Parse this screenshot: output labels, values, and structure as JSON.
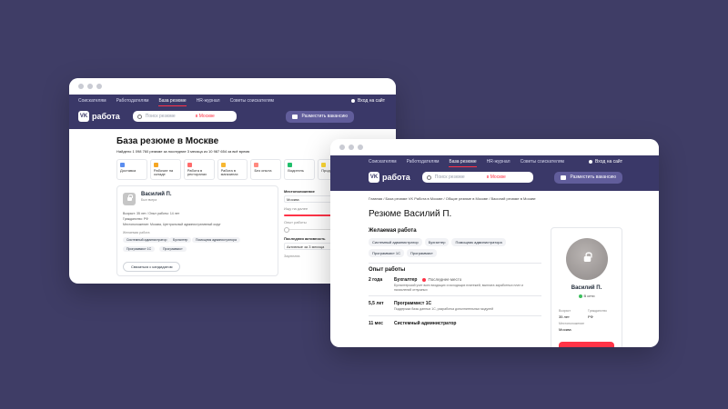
{
  "brand": {
    "logo_mark": "VK",
    "logo_text": "работа"
  },
  "nav": {
    "items": [
      "Соискателям",
      "Работодателям",
      "База резюме",
      "HR-журнал",
      "Советы соискателям"
    ],
    "active_index": 2,
    "login": "Вход на сайт"
  },
  "search": {
    "placeholder": "Поиск резюме",
    "city": "в Москве"
  },
  "post_vacancy": "Разместить вакансию",
  "base_page": {
    "title": "База резюме в Москве",
    "subtitle": "Найдено 1 098 760 резюме за последние 3 месяца из 10 987 654 за всё время",
    "categories": [
      {
        "label": "Доставка",
        "color": "#5b8def",
        "icon": "delivery-icon"
      },
      {
        "label": "Рабочие на складе",
        "color": "#f5a623",
        "icon": "warehouse-icon"
      },
      {
        "label": "Работа в ресторанах",
        "color": "#ff6b6b",
        "icon": "restaurant-icon"
      },
      {
        "label": "Работа в магазинах",
        "color": "#f7b731",
        "icon": "store-icon"
      },
      {
        "label": "Без опыта",
        "color": "#ff8a80",
        "icon": "no-experience-icon"
      },
      {
        "label": "Водитель",
        "color": "#20bf6b",
        "icon": "driver-icon"
      },
      {
        "label": "Прод",
        "color": "#fdd835",
        "icon": "sales-icon"
      }
    ],
    "card": {
      "name": "Василий П.",
      "online": "Был вчера",
      "age_exp": "Возраст: 35 лет / Опыт работы: 14 лет",
      "citizenship": "Гражданство: РФ",
      "location": "Местоположение: Москва, Центральный административный округ",
      "desired_label": "Желаемая работа",
      "chips": [
        "Системный администратор",
        "Бухгалтер",
        "Помощник администратора",
        "Программист 1С",
        "Программист"
      ],
      "contact": "Связаться с кандидатом"
    },
    "filters": {
      "location_label": "Местоположение",
      "location_value": "Москва",
      "age_label": "Ищу на далее",
      "experience_label": "Опыт работы",
      "activity_label": "Последняя активность",
      "activity_value": "Активные за 3 месяца",
      "salary_label": "Зарплата"
    }
  },
  "resume_page": {
    "breadcrumb": "Главная / База резюме VK Работа в Москве / Общие резюме в Москве / Василий резюме в Москве",
    "title": "Резюме Василий П.",
    "desired_title": "Желаемая работа",
    "chips": [
      "Системный администратор",
      "Бухгалтер",
      "Помощник администратора",
      "Программист 1С",
      "Программист"
    ],
    "experience_title": "Опыт работы",
    "experience": [
      {
        "duration": "2 года",
        "title": "Бухгалтер",
        "tag": "Последнее место",
        "desc": "Бухгалтерский учет всех входящих и исходящих платежей, выплата заработных плат и начислений отпускных"
      },
      {
        "duration": "5,5 лет",
        "title": "Программист 1С",
        "tag": "",
        "desc": "Поддержка базы данных 1С, разработка дополнительных модулей"
      },
      {
        "duration": "11 мес",
        "title": "Системный администратор",
        "tag": "",
        "desc": ""
      }
    ],
    "profile": {
      "name": "Василий П.",
      "status": "В сети",
      "age_label": "Возраст",
      "age_value": "35 лет",
      "citizenship_label": "Гражданство",
      "citizenship_value": "РФ",
      "location_label": "Местоположение",
      "location_value": "Москва"
    }
  }
}
